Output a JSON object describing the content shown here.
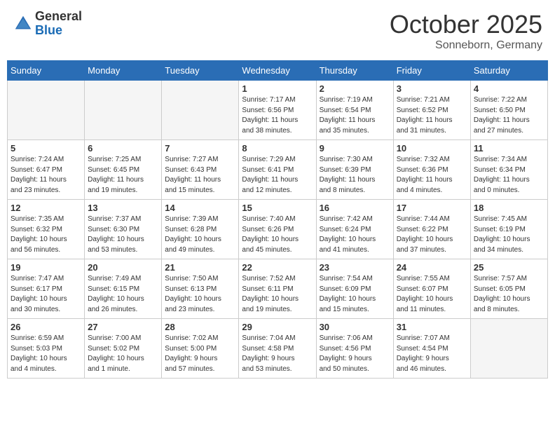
{
  "header": {
    "logo_general": "General",
    "logo_blue": "Blue",
    "month": "October 2025",
    "location": "Sonneborn, Germany"
  },
  "weekdays": [
    "Sunday",
    "Monday",
    "Tuesday",
    "Wednesday",
    "Thursday",
    "Friday",
    "Saturday"
  ],
  "weeks": [
    [
      {
        "day": "",
        "info": ""
      },
      {
        "day": "",
        "info": ""
      },
      {
        "day": "",
        "info": ""
      },
      {
        "day": "1",
        "info": "Sunrise: 7:17 AM\nSunset: 6:56 PM\nDaylight: 11 hours\nand 38 minutes."
      },
      {
        "day": "2",
        "info": "Sunrise: 7:19 AM\nSunset: 6:54 PM\nDaylight: 11 hours\nand 35 minutes."
      },
      {
        "day": "3",
        "info": "Sunrise: 7:21 AM\nSunset: 6:52 PM\nDaylight: 11 hours\nand 31 minutes."
      },
      {
        "day": "4",
        "info": "Sunrise: 7:22 AM\nSunset: 6:50 PM\nDaylight: 11 hours\nand 27 minutes."
      }
    ],
    [
      {
        "day": "5",
        "info": "Sunrise: 7:24 AM\nSunset: 6:47 PM\nDaylight: 11 hours\nand 23 minutes."
      },
      {
        "day": "6",
        "info": "Sunrise: 7:25 AM\nSunset: 6:45 PM\nDaylight: 11 hours\nand 19 minutes."
      },
      {
        "day": "7",
        "info": "Sunrise: 7:27 AM\nSunset: 6:43 PM\nDaylight: 11 hours\nand 15 minutes."
      },
      {
        "day": "8",
        "info": "Sunrise: 7:29 AM\nSunset: 6:41 PM\nDaylight: 11 hours\nand 12 minutes."
      },
      {
        "day": "9",
        "info": "Sunrise: 7:30 AM\nSunset: 6:39 PM\nDaylight: 11 hours\nand 8 minutes."
      },
      {
        "day": "10",
        "info": "Sunrise: 7:32 AM\nSunset: 6:36 PM\nDaylight: 11 hours\nand 4 minutes."
      },
      {
        "day": "11",
        "info": "Sunrise: 7:34 AM\nSunset: 6:34 PM\nDaylight: 11 hours\nand 0 minutes."
      }
    ],
    [
      {
        "day": "12",
        "info": "Sunrise: 7:35 AM\nSunset: 6:32 PM\nDaylight: 10 hours\nand 56 minutes."
      },
      {
        "day": "13",
        "info": "Sunrise: 7:37 AM\nSunset: 6:30 PM\nDaylight: 10 hours\nand 53 minutes."
      },
      {
        "day": "14",
        "info": "Sunrise: 7:39 AM\nSunset: 6:28 PM\nDaylight: 10 hours\nand 49 minutes."
      },
      {
        "day": "15",
        "info": "Sunrise: 7:40 AM\nSunset: 6:26 PM\nDaylight: 10 hours\nand 45 minutes."
      },
      {
        "day": "16",
        "info": "Sunrise: 7:42 AM\nSunset: 6:24 PM\nDaylight: 10 hours\nand 41 minutes."
      },
      {
        "day": "17",
        "info": "Sunrise: 7:44 AM\nSunset: 6:22 PM\nDaylight: 10 hours\nand 37 minutes."
      },
      {
        "day": "18",
        "info": "Sunrise: 7:45 AM\nSunset: 6:19 PM\nDaylight: 10 hours\nand 34 minutes."
      }
    ],
    [
      {
        "day": "19",
        "info": "Sunrise: 7:47 AM\nSunset: 6:17 PM\nDaylight: 10 hours\nand 30 minutes."
      },
      {
        "day": "20",
        "info": "Sunrise: 7:49 AM\nSunset: 6:15 PM\nDaylight: 10 hours\nand 26 minutes."
      },
      {
        "day": "21",
        "info": "Sunrise: 7:50 AM\nSunset: 6:13 PM\nDaylight: 10 hours\nand 23 minutes."
      },
      {
        "day": "22",
        "info": "Sunrise: 7:52 AM\nSunset: 6:11 PM\nDaylight: 10 hours\nand 19 minutes."
      },
      {
        "day": "23",
        "info": "Sunrise: 7:54 AM\nSunset: 6:09 PM\nDaylight: 10 hours\nand 15 minutes."
      },
      {
        "day": "24",
        "info": "Sunrise: 7:55 AM\nSunset: 6:07 PM\nDaylight: 10 hours\nand 11 minutes."
      },
      {
        "day": "25",
        "info": "Sunrise: 7:57 AM\nSunset: 6:05 PM\nDaylight: 10 hours\nand 8 minutes."
      }
    ],
    [
      {
        "day": "26",
        "info": "Sunrise: 6:59 AM\nSunset: 5:03 PM\nDaylight: 10 hours\nand 4 minutes."
      },
      {
        "day": "27",
        "info": "Sunrise: 7:00 AM\nSunset: 5:02 PM\nDaylight: 10 hours\nand 1 minute."
      },
      {
        "day": "28",
        "info": "Sunrise: 7:02 AM\nSunset: 5:00 PM\nDaylight: 9 hours\nand 57 minutes."
      },
      {
        "day": "29",
        "info": "Sunrise: 7:04 AM\nSunset: 4:58 PM\nDaylight: 9 hours\nand 53 minutes."
      },
      {
        "day": "30",
        "info": "Sunrise: 7:06 AM\nSunset: 4:56 PM\nDaylight: 9 hours\nand 50 minutes."
      },
      {
        "day": "31",
        "info": "Sunrise: 7:07 AM\nSunset: 4:54 PM\nDaylight: 9 hours\nand 46 minutes."
      },
      {
        "day": "",
        "info": ""
      }
    ]
  ]
}
